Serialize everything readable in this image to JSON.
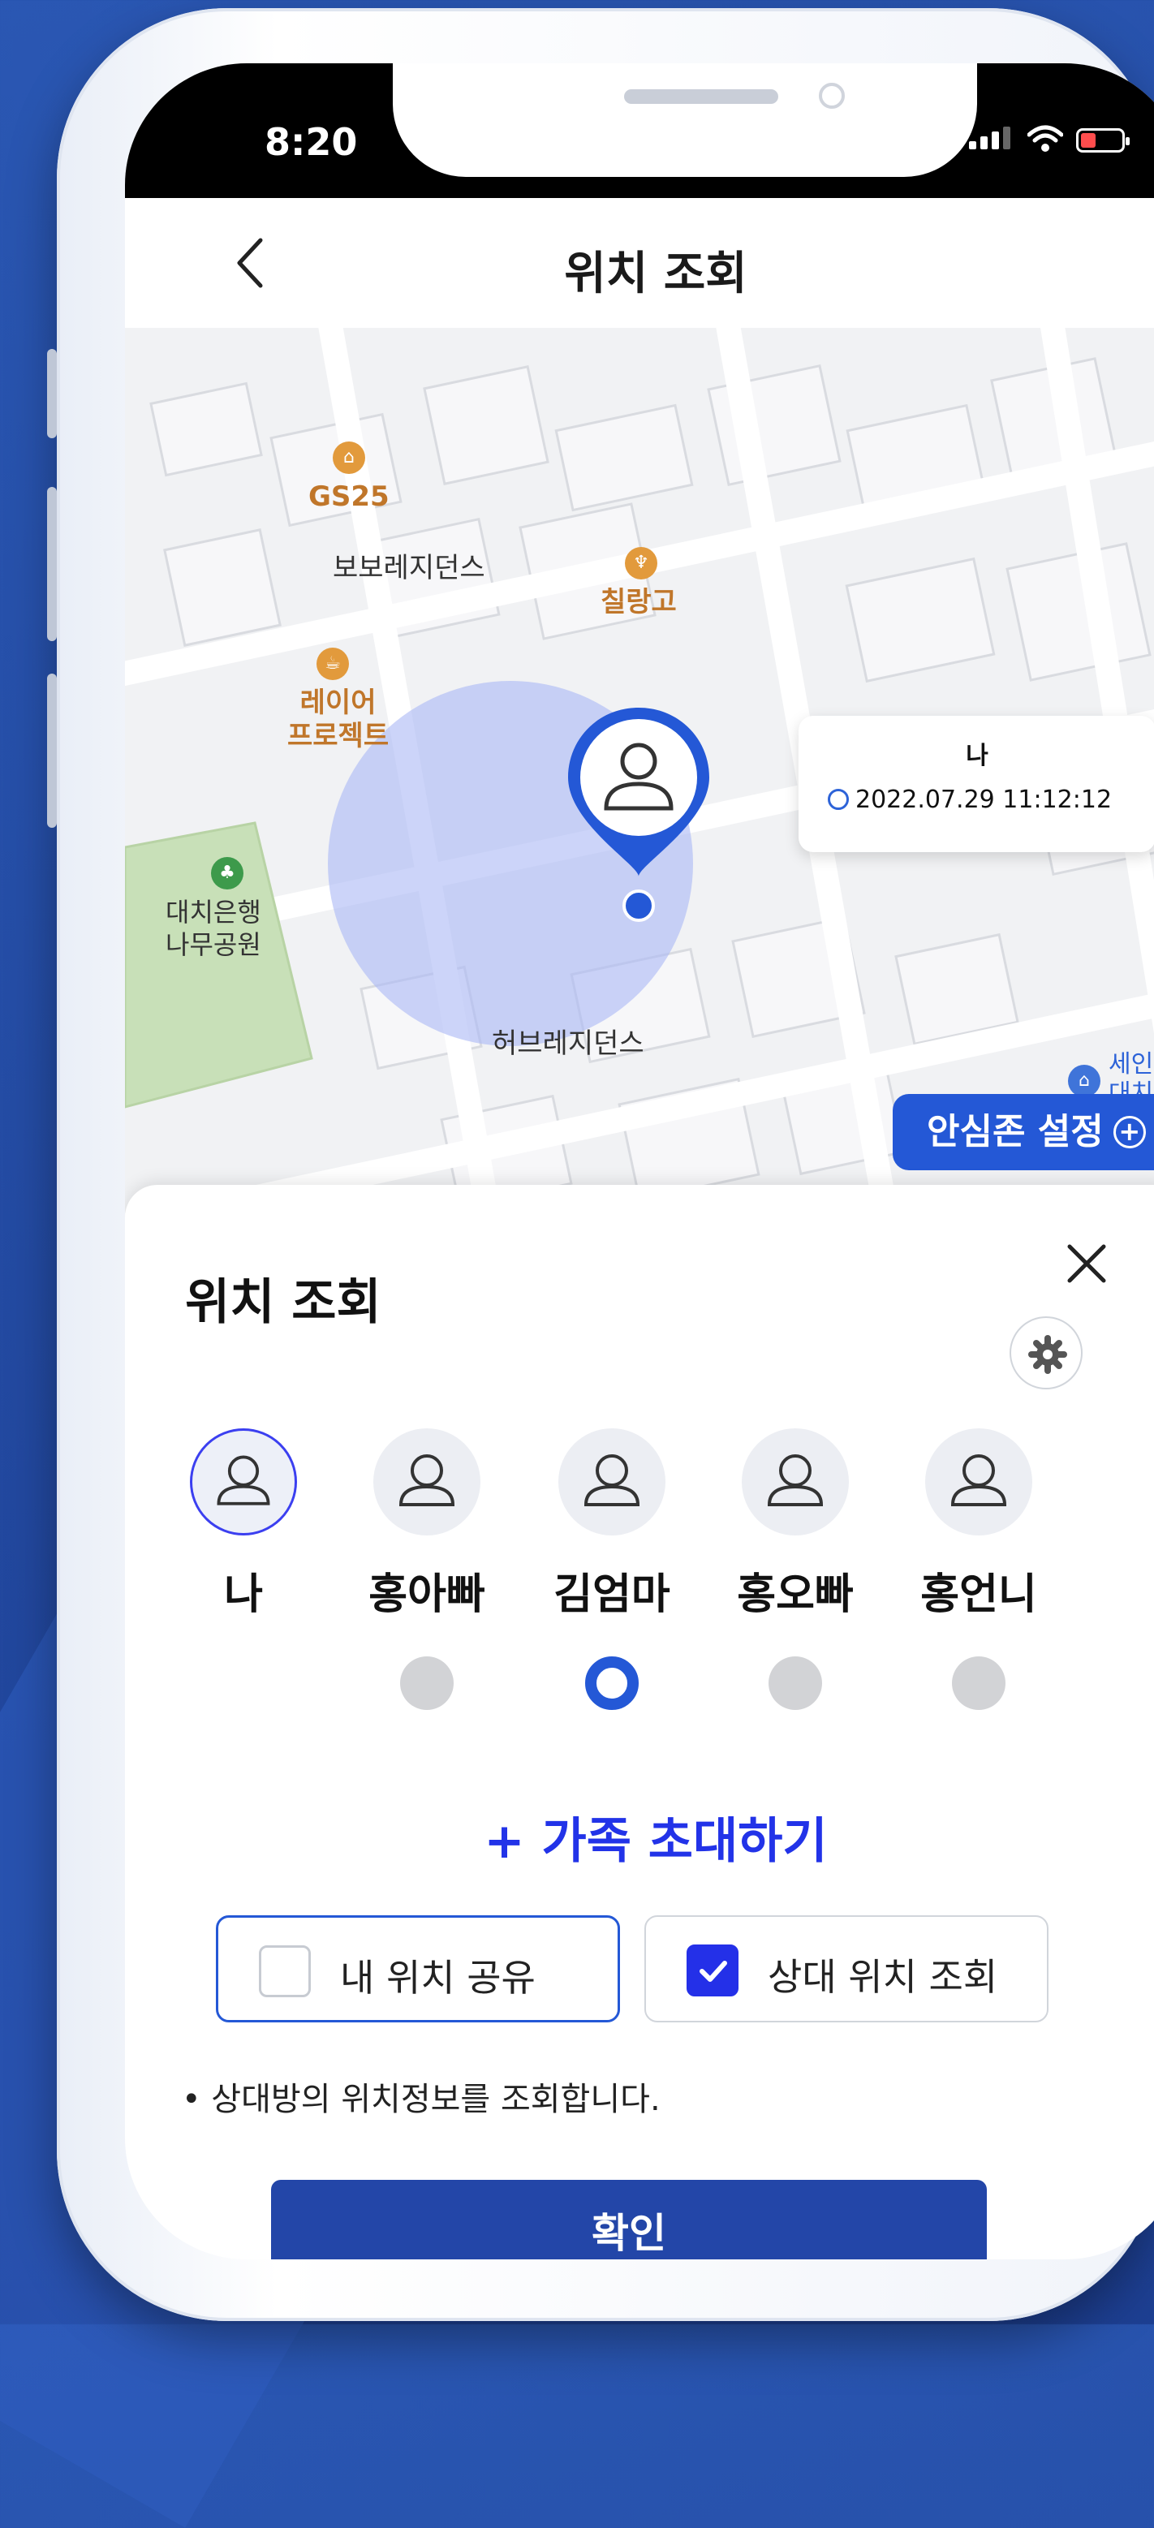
{
  "status_bar": {
    "time": "8:20"
  },
  "header": {
    "title": "위치 조회"
  },
  "map": {
    "pois": {
      "gs25": "GS25",
      "bobo": "보보레지던스",
      "chilranggo": "칠랑고",
      "layer_project": "레이어\n프로젝트",
      "park": "대치은행\n나무공원",
      "hub": "허브레지던스",
      "saint": "세인트\n대치학"
    },
    "bubble": {
      "name": "나",
      "time": "2022.07.29 11:12:12"
    },
    "safezone_button": "안심존 설정"
  },
  "sheet": {
    "title": "위치 조회",
    "members": [
      {
        "name": "나",
        "avatar_selected": true,
        "radio_selected": false,
        "has_radio": false
      },
      {
        "name": "홍아빠",
        "avatar_selected": false,
        "radio_selected": false,
        "has_radio": true
      },
      {
        "name": "김엄마",
        "avatar_selected": false,
        "radio_selected": true,
        "has_radio": true
      },
      {
        "name": "홍오빠",
        "avatar_selected": false,
        "radio_selected": false,
        "has_radio": true
      },
      {
        "name": "홍언니",
        "avatar_selected": false,
        "radio_selected": false,
        "has_radio": true
      }
    ],
    "invite_label": "+ 가족 초대하기",
    "share_my_location": {
      "label": "내 위치 공유",
      "checked": false
    },
    "view_other_location": {
      "label": "상대 위치 조회",
      "checked": true
    },
    "hint": "• 상대방의 위치정보를 조회합니다.",
    "confirm_label": "확인"
  },
  "colors": {
    "primary": "#2458d6",
    "confirm": "#2346a8",
    "invite": "#2233e8",
    "background": "#22489f"
  }
}
